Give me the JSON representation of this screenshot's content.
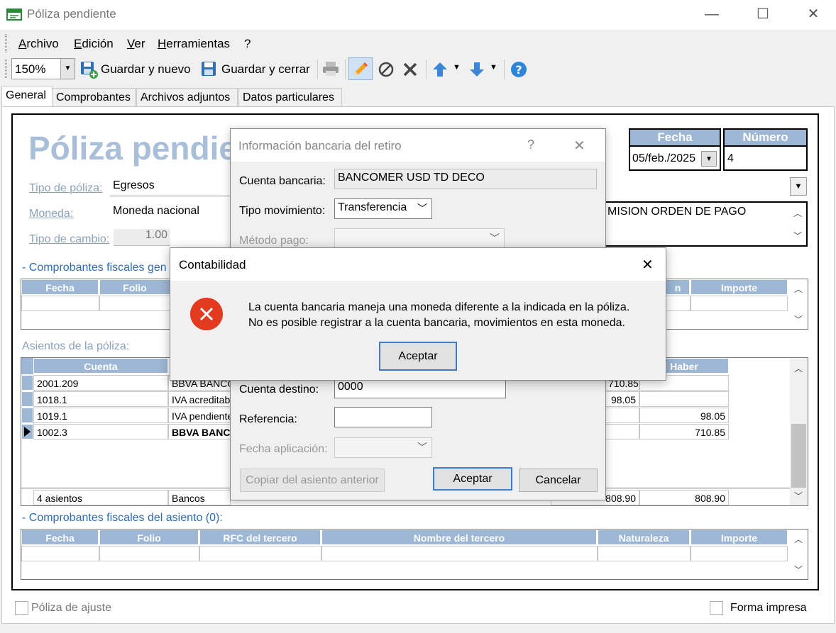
{
  "window": {
    "title": "Póliza pendiente",
    "controls": {
      "minimize": "—",
      "maximize": "☐",
      "close": "✕"
    }
  },
  "menu": [
    "Archivo",
    "Edición",
    "Ver",
    "Herramientas",
    "?"
  ],
  "toolbar": {
    "zoom": "150%",
    "save_new": "Guardar y nuevo",
    "save_close": "Guardar y cerrar"
  },
  "tabs": [
    "General",
    "Comprobantes",
    "Archivos adjuntos",
    "Datos particulares"
  ],
  "form": {
    "heading": "Póliza pendie",
    "tipo_poliza_label": "Tipo de póliza:",
    "tipo_poliza_value": "Egresos",
    "moneda_label": "Moneda:",
    "moneda_value": "Moneda nacional",
    "tipo_cambio_label": "Tipo de cambio:",
    "tipo_cambio_value": "1.00",
    "fecha_label": "Fecha",
    "fecha_value": "05/feb./2025",
    "numero_label": "Número",
    "numero_value": "4",
    "concepto_value": "MISION ORDEN DE PAGO"
  },
  "sections": {
    "cf_generales": "- Comprobantes fiscales gen",
    "asientos": "Asientos de la póliza:",
    "cf_asiento": "- Comprobantes fiscales del asiento (0):"
  },
  "cf_top_headers": [
    "Fecha",
    "Folio",
    "n",
    "Importe"
  ],
  "asientos_grid": {
    "headers": [
      "Cuenta",
      "Haber"
    ],
    "rows": [
      {
        "cuenta": "2001.209",
        "nombre": "BBVA BANCON",
        "debe": "710.85",
        "haber": ""
      },
      {
        "cuenta": "1018.1",
        "nombre": "IVA acreditable",
        "debe": "98.05",
        "haber": ""
      },
      {
        "cuenta": "1019.1",
        "nombre": "IVA pendiente",
        "debe": "",
        "haber": "98.05"
      },
      {
        "cuenta": "1002.3",
        "nombre": "BBVA BANC",
        "debe": "",
        "haber": "710.85"
      }
    ],
    "footer": {
      "count": "4 asientos",
      "nombre": "Bancos",
      "debe": "808.90",
      "haber": "808.90"
    }
  },
  "cf_bottom_headers": [
    "Fecha",
    "Folio",
    "RFC del tercero",
    "Nombre del tercero",
    "Naturaleza",
    "Importe"
  ],
  "checks": {
    "ajuste": "Póliza de ajuste",
    "impresa": "Forma impresa"
  },
  "bank_dialog": {
    "title": "Información bancaria del retiro",
    "help": "?",
    "close": "✕",
    "cuenta_label": "Cuenta bancaria:",
    "cuenta_value": "BANCOMER USD TD DECO",
    "tipo_mov_label": "Tipo movimiento:",
    "tipo_mov_value": "Transferencia",
    "metodo_label": "Método pago:",
    "destino_label": "Cuenta destino:",
    "destino_value": "0000",
    "referencia_label": "Referencia:",
    "fecha_aplic_label": "Fecha aplicación:",
    "copy_btn": "Copiar del asiento anterior",
    "ok_btn": "Aceptar",
    "cancel_btn": "Cancelar"
  },
  "error_dialog": {
    "title": "Contabilidad",
    "close": "✕",
    "line1": "La cuenta bancaria maneja una moneda diferente a la indicada en la póliza.",
    "line2": "No es posible registrar a la cuenta bancaria, movimientos en esta moneda.",
    "ok_btn": "Aceptar"
  },
  "colors": {
    "grid_header": "#9db7d4",
    "heading": "#a9bfd9",
    "section": "#2d6cb3",
    "error": "#e23a1f",
    "accent_button": "#3b7bc8"
  }
}
